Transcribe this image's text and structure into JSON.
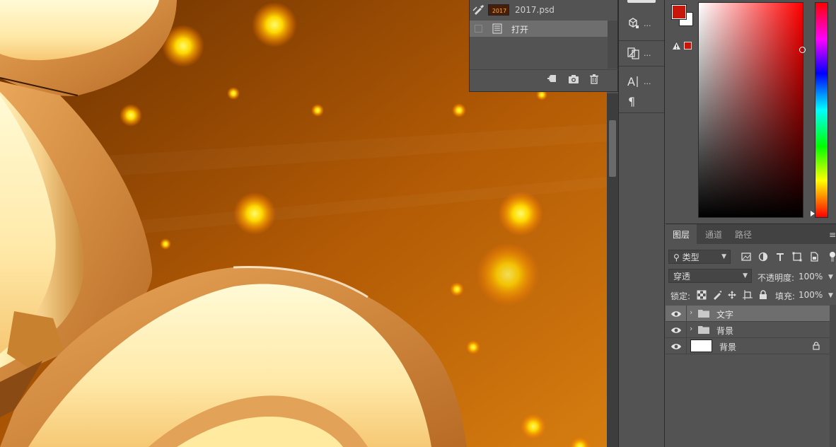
{
  "history": {
    "snapshot_name": "2017.psd",
    "step_label": "打开"
  },
  "color": {
    "foreground": "#c8160a",
    "background": "#ffffff"
  },
  "layers": {
    "tabs": [
      "图层",
      "通道",
      "路径"
    ],
    "active_tab": "图层",
    "filter_label": "类型",
    "blend_mode": "穿透",
    "opacity_label": "不透明度:",
    "opacity_value": "100%",
    "lock_label": "锁定:",
    "fill_label": "填充:",
    "fill_value": "100%",
    "items": [
      {
        "name": "文字",
        "kind": "group",
        "visible": true,
        "selected": true
      },
      {
        "name": "背景",
        "kind": "group",
        "visible": true,
        "selected": false
      },
      {
        "name": "背景",
        "kind": "pixel",
        "visible": true,
        "selected": false,
        "locked": true
      }
    ]
  },
  "strip": {
    "dots": "..."
  }
}
